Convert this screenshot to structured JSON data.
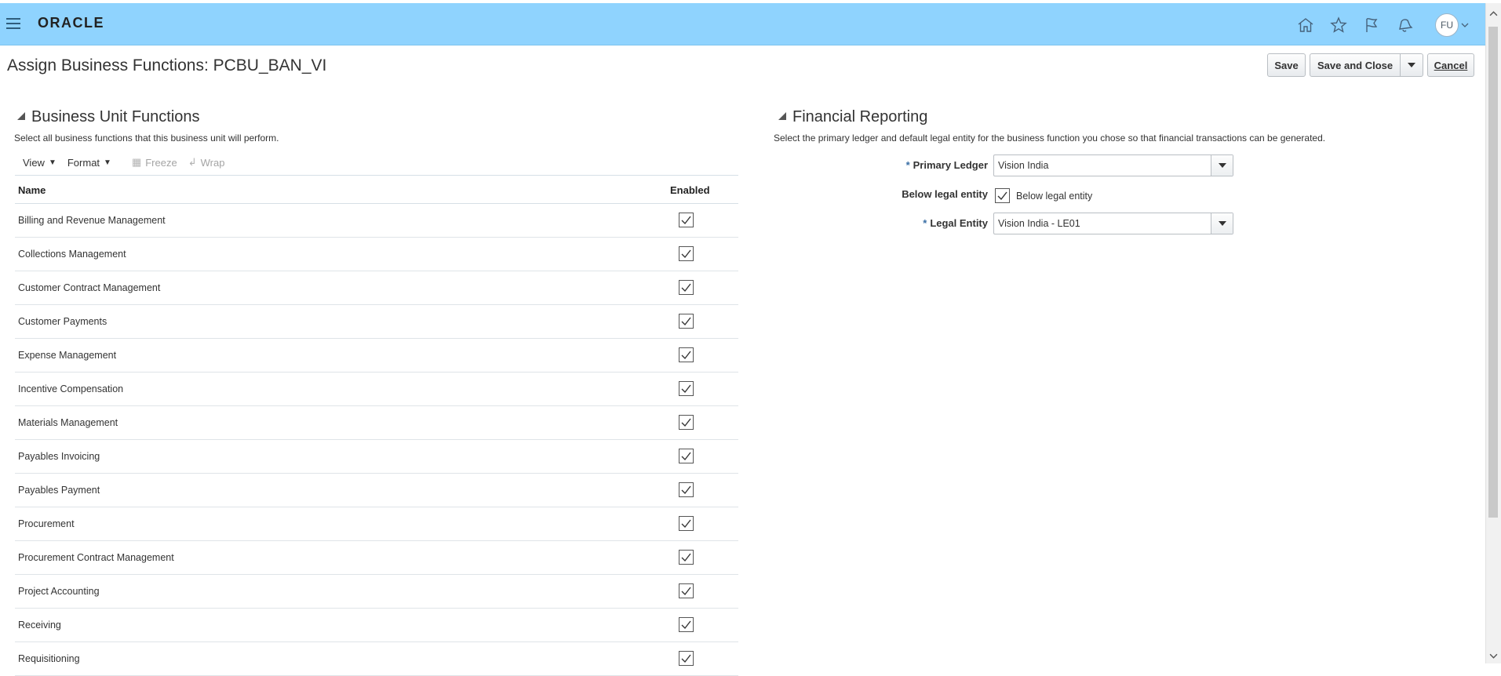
{
  "header": {
    "logo": "ORACLE",
    "icons": [
      "home-icon",
      "star-icon",
      "flag-icon",
      "bell-icon"
    ],
    "avatar_initials": "FU",
    "accent": "#8fd3fe"
  },
  "page": {
    "title": "Assign Business Functions: PCBU_BAN_VI",
    "buttons": {
      "save": "Save",
      "save_and_close": "Save and Close",
      "cancel": "Cancel"
    }
  },
  "business_unit_functions": {
    "heading": "Business Unit Functions",
    "description": "Select all business functions that this business unit will perform.",
    "toolbar": {
      "view": "View",
      "format": "Format",
      "freeze": "Freeze",
      "wrap": "Wrap"
    },
    "columns": [
      "Name",
      "Enabled"
    ],
    "rows": [
      {
        "name": "Billing and Revenue Management",
        "enabled": true
      },
      {
        "name": "Collections Management",
        "enabled": true
      },
      {
        "name": "Customer Contract Management",
        "enabled": true
      },
      {
        "name": "Customer Payments",
        "enabled": true
      },
      {
        "name": "Expense Management",
        "enabled": true
      },
      {
        "name": "Incentive Compensation",
        "enabled": true
      },
      {
        "name": "Materials Management",
        "enabled": true
      },
      {
        "name": "Payables Invoicing",
        "enabled": true
      },
      {
        "name": "Payables Payment",
        "enabled": true
      },
      {
        "name": "Procurement",
        "enabled": true
      },
      {
        "name": "Procurement Contract Management",
        "enabled": true
      },
      {
        "name": "Project Accounting",
        "enabled": true
      },
      {
        "name": "Receiving",
        "enabled": true
      },
      {
        "name": "Requisitioning",
        "enabled": true
      }
    ]
  },
  "financial_reporting": {
    "heading": "Financial Reporting",
    "description": "Select the primary ledger and default legal entity for the business function you chose so that financial transactions can be generated.",
    "primary_ledger": {
      "label": "Primary Ledger",
      "value": "Vision India",
      "required": "*"
    },
    "below_legal_entity": {
      "label": "Below legal entity",
      "checkbox_label": "Below legal entity",
      "checked": true
    },
    "legal_entity": {
      "label": "Legal Entity",
      "value": "Vision India - LE01",
      "required": "*"
    }
  }
}
